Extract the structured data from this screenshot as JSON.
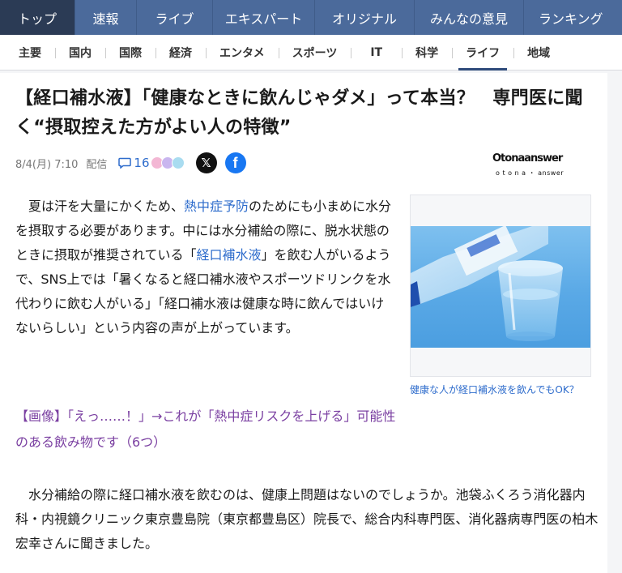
{
  "top_nav": [
    {
      "label": "トップ",
      "active": true
    },
    {
      "label": "速報",
      "active": false
    },
    {
      "label": "ライブ",
      "active": false
    },
    {
      "label": "エキスパート",
      "active": false
    },
    {
      "label": "オリジナル",
      "active": false
    },
    {
      "label": "みんなの意見",
      "active": false
    },
    {
      "label": "ランキング",
      "active": false
    }
  ],
  "sub_nav": [
    {
      "label": "主要",
      "active": false
    },
    {
      "label": "国内",
      "active": false
    },
    {
      "label": "国際",
      "active": false
    },
    {
      "label": "経済",
      "active": false
    },
    {
      "label": "エンタメ",
      "active": false
    },
    {
      "label": "スポーツ",
      "active": false
    },
    {
      "label": "IT",
      "active": false
    },
    {
      "label": "科学",
      "active": false
    },
    {
      "label": "ライフ",
      "active": true
    },
    {
      "label": "地域",
      "active": false
    }
  ],
  "article": {
    "headline": "【経口補水液】「健康なときに飲んじゃダメ」って本当？　専門医に聞く“摂取控えた方がよい人の特徴”",
    "date": "8/4(月) 7:10",
    "delivered": "配信",
    "comment_count": "16",
    "x_label": "𝕏",
    "fb_label": "f",
    "publisher_logo": {
      "big": "Otonaanswer",
      "small": "o t o n a ・ answer"
    },
    "lead": {
      "t1": "夏は汗を大量にかくため、",
      "link1": "熱中症予防",
      "t2": "のためにも小まめに水分を摂取する必要があります。中には水分補給の際に、脱水状態のときに摂取が推奨されている「",
      "link2": "経口補水液",
      "t3": "」を飲む人がいるようで、SNS上では「暑くなると経口補水液やスポーツドリンクを水代わりに飲む人がいる」「経口補水液は健康な時に飲んではいけないらしい」という内容の声が上がっています。"
    },
    "image_caption": "健康な人が経口補水液を飲んでもOK？",
    "related_link": "【画像】「えっ……！」→これが「熱中症リスクを上げる」可能性のある飲み物です（6つ）",
    "body": "水分補給の際に経口補水液を飲むのは、健康上問題はないのでしょうか。池袋ふくろう消化器内科・内視鏡クリニック東京豊島院（東京都豊島区）院長で、総合内科専門医、消化器病専門医の柏木宏幸さんに聞きました。"
  },
  "colors": {
    "nav_bg": "#4b6a9b",
    "nav_active": "#2b3b55",
    "link_blue": "#2e6ccc",
    "related_link_purple": "#7a3fa1",
    "facebook": "#1877f2"
  }
}
